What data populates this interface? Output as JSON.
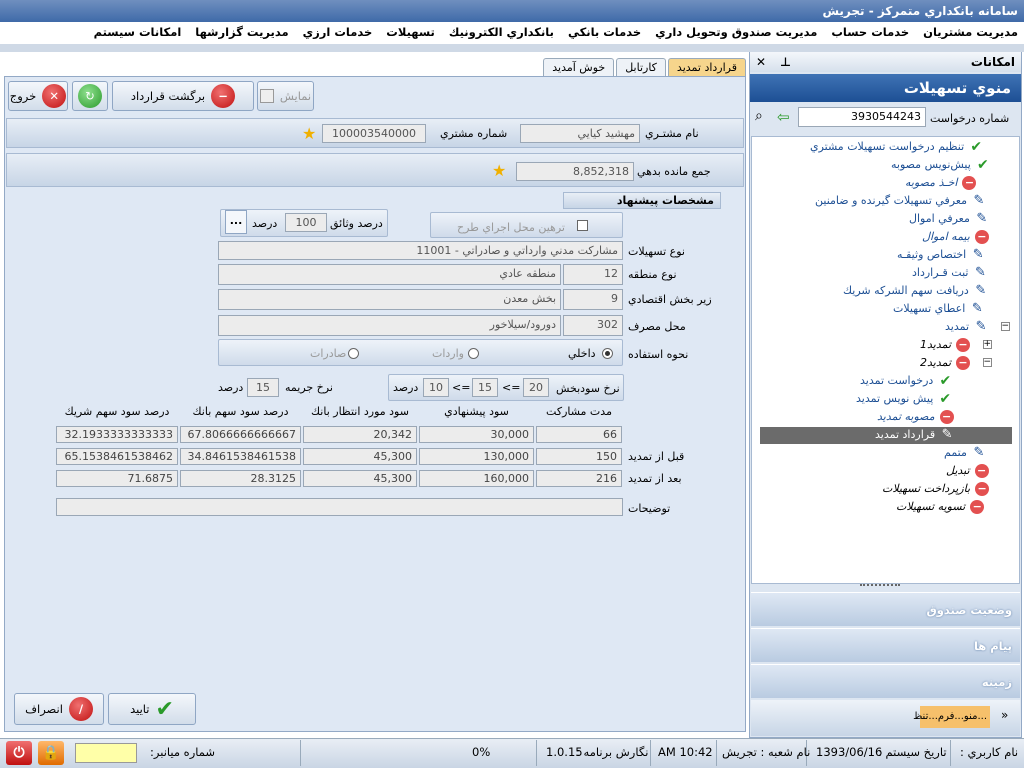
{
  "window": {
    "title": "سامانه بانكداري متمركز - تجريش"
  },
  "menu": [
    "مديريت مشتريان",
    "خدمات حساب",
    "مديريت صندوق وتحويل داري",
    "خدمات بانكي",
    "بانكداري الكترونيك",
    "تسهيلات",
    "خدمات ارزي",
    "مديريت گزارشها",
    "امكانات سيستم"
  ],
  "tabs": [
    "قرارداد تمديد",
    "كارتابل",
    "خوش آمديد"
  ],
  "toolbar": {
    "show": "نمايش",
    "return_contract": "برگشت قرارداد",
    "exit": "خروج"
  },
  "customer": {
    "name_label": "نام مشتـري",
    "name": "مهشيد كيايي",
    "number_label": "شماره مشتري",
    "number": "100003540000"
  },
  "debt": {
    "label": "جمع مانده بدهي",
    "value": "8,852,318"
  },
  "proposal_header": "مشخصات پيشنهاد",
  "collateral": {
    "checkbox_label": "ترهين محل اجراي طرح",
    "percent_label": "درصد وثائق",
    "percent_value": "100",
    "percent_unit": "درصد",
    "more": "..."
  },
  "fields": [
    {
      "label": "نوع تسهيلات",
      "code": "",
      "value": "11001 - مشاركت مدني وارداتي و صادراتي"
    },
    {
      "label": "نوع منطقه",
      "code": "12",
      "value": "منطقه عادي"
    },
    {
      "label": "زير بخش اقتصادي",
      "code": "9",
      "value": "بخش معدن"
    },
    {
      "label": "محل مصرف",
      "code": "302",
      "value": "دورود/سيلاخور"
    }
  ],
  "usage": {
    "label": "نحوه استفاده",
    "options": [
      "داخلي",
      "واردات",
      "صادرات"
    ],
    "selected": "داخلي"
  },
  "profit": {
    "label": "نرخ سودبخش",
    "v1": "20",
    "op1": "=>",
    "v2": "15",
    "op2": "=>",
    "v3": "10",
    "unit": "درصد",
    "penalty_label": "نرخ جريمه",
    "penalty": "15",
    "penalty_unit": "درصد"
  },
  "table": {
    "headers": [
      "مدت مشاركت",
      "سود پيشنهادي",
      "سود مورد انتظار بانك",
      "درصد سود سهم بانك",
      "درصد سود سهم شريك"
    ],
    "rows": [
      {
        "label": "",
        "cells": [
          "66",
          "30,000",
          "20,342",
          "67.8066666666667",
          "32.1933333333333"
        ]
      },
      {
        "label": "قبل از تمديد",
        "cells": [
          "150",
          "130,000",
          "45,300",
          "34.8461538461538",
          "65.1538461538462"
        ]
      },
      {
        "label": "بعد از تمديد",
        "cells": [
          "216",
          "160,000",
          "45,300",
          "28.3125",
          "71.6875"
        ]
      }
    ]
  },
  "notes": {
    "label": "توضيحات",
    "value": ""
  },
  "actions": {
    "confirm": "تاييد",
    "cancel": "انصراف"
  },
  "rpanel": {
    "header": "امكانات",
    "title": "منوي تسهيلات",
    "request_label": "شماره درخواست",
    "request_value": "3930544243",
    "tree": [
      {
        "label": "تنظيم درخواست تسهيلات مشتري",
        "icon": "check"
      },
      {
        "label": "پيش‌نويس مصوبه",
        "icon": "check"
      },
      {
        "label": "اخـذ مصوبه",
        "icon": "red"
      },
      {
        "label": "معرفي تسهيلات گيرنده و ضامنين",
        "icon": "pen"
      },
      {
        "label": "معرفي اموال",
        "icon": "pen"
      },
      {
        "label": "بيمه اموال",
        "icon": "red"
      },
      {
        "label": "اختصاص وثيقـه",
        "icon": "pen"
      },
      {
        "label": "ثبت قـرارداد",
        "icon": "pen"
      },
      {
        "label": "دريافت سهم الشركه شريك",
        "icon": "pen"
      },
      {
        "label": "اعطاي تسهيلات",
        "icon": "pen"
      },
      {
        "label": "تمديد",
        "icon": "pen"
      },
      {
        "label": "تمديد1",
        "icon": "red"
      },
      {
        "label": "تمديد2",
        "icon": "red"
      },
      {
        "label": "درخواست تمديد",
        "icon": "check"
      },
      {
        "label": "پيش نويس تمديد",
        "icon": "check"
      },
      {
        "label": "مصوبه تمديد",
        "icon": "red"
      },
      {
        "label": "قرارداد تمديد",
        "icon": "pen"
      },
      {
        "label": "متمم",
        "icon": "pen"
      },
      {
        "label": "تبديل",
        "icon": "red"
      },
      {
        "label": "بازپرداخت تسهيلات",
        "icon": "red"
      },
      {
        "label": "تسويه تسهيلات",
        "icon": "red"
      }
    ],
    "sections": [
      "وضعيت صندوق",
      "پيام ها",
      "زمينه"
    ],
    "bottom_text": "...منو...فرم...تنظ"
  },
  "statusbar": {
    "user": "نام كاربري :",
    "date_label": "تاريخ سيستم :",
    "date": "1393/06/16",
    "branch": "نام شعبه : تجريش",
    "time": "10:42 AM",
    "version_label": "نگارش برنامه :",
    "version": "1.0.15",
    "progress": "0%",
    "short_number": "شماره ميانبر:"
  }
}
